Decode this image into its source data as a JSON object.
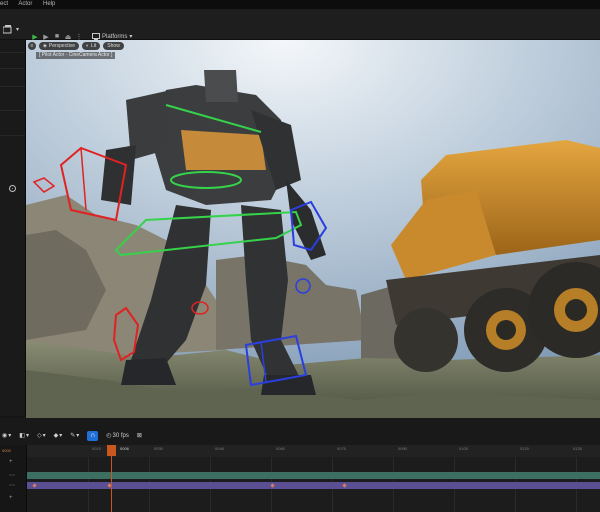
{
  "menubar": {
    "items": [
      "ect",
      "Actor",
      "Help"
    ]
  },
  "toolbar": {
    "platforms_label": "Platforms"
  },
  "viewport": {
    "perspective_label": "Perspective",
    "lit_label": "Lit",
    "show_label": "Show",
    "actor_label": "[ Pilot Actor - CineCamera Actor ]"
  },
  "timeline": {
    "fps_label": "30 fps",
    "current_frame": "0006",
    "start_frame": "0000",
    "ruler_labels": [
      "0015",
      "0030",
      "0045",
      "0060",
      "0075",
      "0090",
      "0105",
      "0120",
      "0135",
      "0150"
    ]
  },
  "colors": {
    "accent_blue": "#1f6fd6",
    "playhead": "#c8581e",
    "play_green": "#3bb54a"
  }
}
